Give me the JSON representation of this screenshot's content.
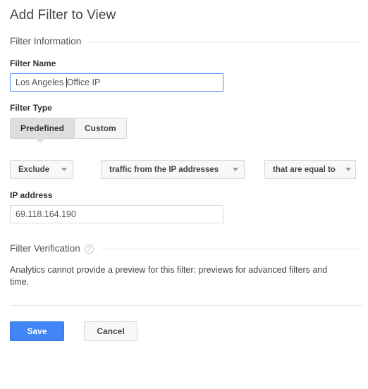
{
  "page": {
    "title": "Add Filter to View"
  },
  "filter_information": {
    "section_label": "Filter Information",
    "filter_name": {
      "label": "Filter Name",
      "value_before_caret": "Los Angeles ",
      "value_after_caret": "Office IP",
      "value": "Los Angeles Office IP",
      "placeholder": ""
    },
    "filter_type": {
      "label": "Filter Type",
      "tabs": [
        {
          "label": "Predefined",
          "selected": true
        },
        {
          "label": "Custom",
          "selected": false
        }
      ]
    },
    "dropdowns": [
      {
        "name": "filter-action",
        "value": "Exclude",
        "caret": "chevron-down-icon"
      },
      {
        "name": "filter-source",
        "value": "traffic from the IP addresses",
        "caret": "chevron-down-icon"
      },
      {
        "name": "filter-match-type",
        "value": "that are equal to",
        "caret": "chevron-down-icon"
      }
    ],
    "ip_address": {
      "label": "IP address",
      "value": "69.118.164.190",
      "placeholder": ""
    }
  },
  "filter_verification": {
    "section_label": "Filter Verification",
    "help_icon": "help-circle-icon",
    "help_glyph": "?",
    "message": "Analytics cannot provide a preview for this filter: previews for advanced filters and\ntime."
  },
  "footer": {
    "save_label": "Save",
    "cancel_label": "Cancel"
  },
  "colors": {
    "accent_blue": "#4285f4",
    "focus_border": "#4d90fe",
    "tab_selected_bg": "#dedede",
    "border_gray": "#d6d6d6",
    "rule_gray": "#e4e4e4"
  }
}
